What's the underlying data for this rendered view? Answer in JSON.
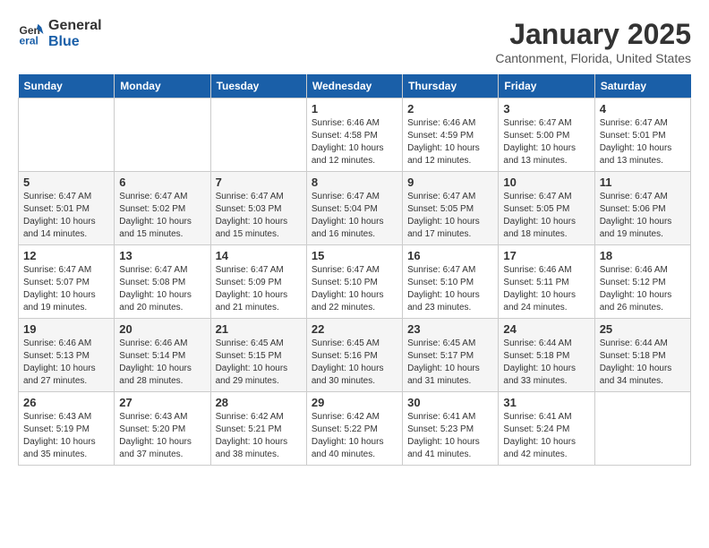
{
  "header": {
    "logo_line1": "General",
    "logo_line2": "Blue",
    "month_title": "January 2025",
    "location": "Cantonment, Florida, United States"
  },
  "weekdays": [
    "Sunday",
    "Monday",
    "Tuesday",
    "Wednesday",
    "Thursday",
    "Friday",
    "Saturday"
  ],
  "weeks": [
    [
      {
        "day": "",
        "sunrise": "",
        "sunset": "",
        "daylight": ""
      },
      {
        "day": "",
        "sunrise": "",
        "sunset": "",
        "daylight": ""
      },
      {
        "day": "",
        "sunrise": "",
        "sunset": "",
        "daylight": ""
      },
      {
        "day": "1",
        "sunrise": "Sunrise: 6:46 AM",
        "sunset": "Sunset: 4:58 PM",
        "daylight": "Daylight: 10 hours and 12 minutes."
      },
      {
        "day": "2",
        "sunrise": "Sunrise: 6:46 AM",
        "sunset": "Sunset: 4:59 PM",
        "daylight": "Daylight: 10 hours and 12 minutes."
      },
      {
        "day": "3",
        "sunrise": "Sunrise: 6:47 AM",
        "sunset": "Sunset: 5:00 PM",
        "daylight": "Daylight: 10 hours and 13 minutes."
      },
      {
        "day": "4",
        "sunrise": "Sunrise: 6:47 AM",
        "sunset": "Sunset: 5:01 PM",
        "daylight": "Daylight: 10 hours and 13 minutes."
      }
    ],
    [
      {
        "day": "5",
        "sunrise": "Sunrise: 6:47 AM",
        "sunset": "Sunset: 5:01 PM",
        "daylight": "Daylight: 10 hours and 14 minutes."
      },
      {
        "day": "6",
        "sunrise": "Sunrise: 6:47 AM",
        "sunset": "Sunset: 5:02 PM",
        "daylight": "Daylight: 10 hours and 15 minutes."
      },
      {
        "day": "7",
        "sunrise": "Sunrise: 6:47 AM",
        "sunset": "Sunset: 5:03 PM",
        "daylight": "Daylight: 10 hours and 15 minutes."
      },
      {
        "day": "8",
        "sunrise": "Sunrise: 6:47 AM",
        "sunset": "Sunset: 5:04 PM",
        "daylight": "Daylight: 10 hours and 16 minutes."
      },
      {
        "day": "9",
        "sunrise": "Sunrise: 6:47 AM",
        "sunset": "Sunset: 5:05 PM",
        "daylight": "Daylight: 10 hours and 17 minutes."
      },
      {
        "day": "10",
        "sunrise": "Sunrise: 6:47 AM",
        "sunset": "Sunset: 5:05 PM",
        "daylight": "Daylight: 10 hours and 18 minutes."
      },
      {
        "day": "11",
        "sunrise": "Sunrise: 6:47 AM",
        "sunset": "Sunset: 5:06 PM",
        "daylight": "Daylight: 10 hours and 19 minutes."
      }
    ],
    [
      {
        "day": "12",
        "sunrise": "Sunrise: 6:47 AM",
        "sunset": "Sunset: 5:07 PM",
        "daylight": "Daylight: 10 hours and 19 minutes."
      },
      {
        "day": "13",
        "sunrise": "Sunrise: 6:47 AM",
        "sunset": "Sunset: 5:08 PM",
        "daylight": "Daylight: 10 hours and 20 minutes."
      },
      {
        "day": "14",
        "sunrise": "Sunrise: 6:47 AM",
        "sunset": "Sunset: 5:09 PM",
        "daylight": "Daylight: 10 hours and 21 minutes."
      },
      {
        "day": "15",
        "sunrise": "Sunrise: 6:47 AM",
        "sunset": "Sunset: 5:10 PM",
        "daylight": "Daylight: 10 hours and 22 minutes."
      },
      {
        "day": "16",
        "sunrise": "Sunrise: 6:47 AM",
        "sunset": "Sunset: 5:10 PM",
        "daylight": "Daylight: 10 hours and 23 minutes."
      },
      {
        "day": "17",
        "sunrise": "Sunrise: 6:46 AM",
        "sunset": "Sunset: 5:11 PM",
        "daylight": "Daylight: 10 hours and 24 minutes."
      },
      {
        "day": "18",
        "sunrise": "Sunrise: 6:46 AM",
        "sunset": "Sunset: 5:12 PM",
        "daylight": "Daylight: 10 hours and 26 minutes."
      }
    ],
    [
      {
        "day": "19",
        "sunrise": "Sunrise: 6:46 AM",
        "sunset": "Sunset: 5:13 PM",
        "daylight": "Daylight: 10 hours and 27 minutes."
      },
      {
        "day": "20",
        "sunrise": "Sunrise: 6:46 AM",
        "sunset": "Sunset: 5:14 PM",
        "daylight": "Daylight: 10 hours and 28 minutes."
      },
      {
        "day": "21",
        "sunrise": "Sunrise: 6:45 AM",
        "sunset": "Sunset: 5:15 PM",
        "daylight": "Daylight: 10 hours and 29 minutes."
      },
      {
        "day": "22",
        "sunrise": "Sunrise: 6:45 AM",
        "sunset": "Sunset: 5:16 PM",
        "daylight": "Daylight: 10 hours and 30 minutes."
      },
      {
        "day": "23",
        "sunrise": "Sunrise: 6:45 AM",
        "sunset": "Sunset: 5:17 PM",
        "daylight": "Daylight: 10 hours and 31 minutes."
      },
      {
        "day": "24",
        "sunrise": "Sunrise: 6:44 AM",
        "sunset": "Sunset: 5:18 PM",
        "daylight": "Daylight: 10 hours and 33 minutes."
      },
      {
        "day": "25",
        "sunrise": "Sunrise: 6:44 AM",
        "sunset": "Sunset: 5:18 PM",
        "daylight": "Daylight: 10 hours and 34 minutes."
      }
    ],
    [
      {
        "day": "26",
        "sunrise": "Sunrise: 6:43 AM",
        "sunset": "Sunset: 5:19 PM",
        "daylight": "Daylight: 10 hours and 35 minutes."
      },
      {
        "day": "27",
        "sunrise": "Sunrise: 6:43 AM",
        "sunset": "Sunset: 5:20 PM",
        "daylight": "Daylight: 10 hours and 37 minutes."
      },
      {
        "day": "28",
        "sunrise": "Sunrise: 6:42 AM",
        "sunset": "Sunset: 5:21 PM",
        "daylight": "Daylight: 10 hours and 38 minutes."
      },
      {
        "day": "29",
        "sunrise": "Sunrise: 6:42 AM",
        "sunset": "Sunset: 5:22 PM",
        "daylight": "Daylight: 10 hours and 40 minutes."
      },
      {
        "day": "30",
        "sunrise": "Sunrise: 6:41 AM",
        "sunset": "Sunset: 5:23 PM",
        "daylight": "Daylight: 10 hours and 41 minutes."
      },
      {
        "day": "31",
        "sunrise": "Sunrise: 6:41 AM",
        "sunset": "Sunset: 5:24 PM",
        "daylight": "Daylight: 10 hours and 42 minutes."
      },
      {
        "day": "",
        "sunrise": "",
        "sunset": "",
        "daylight": ""
      }
    ]
  ]
}
